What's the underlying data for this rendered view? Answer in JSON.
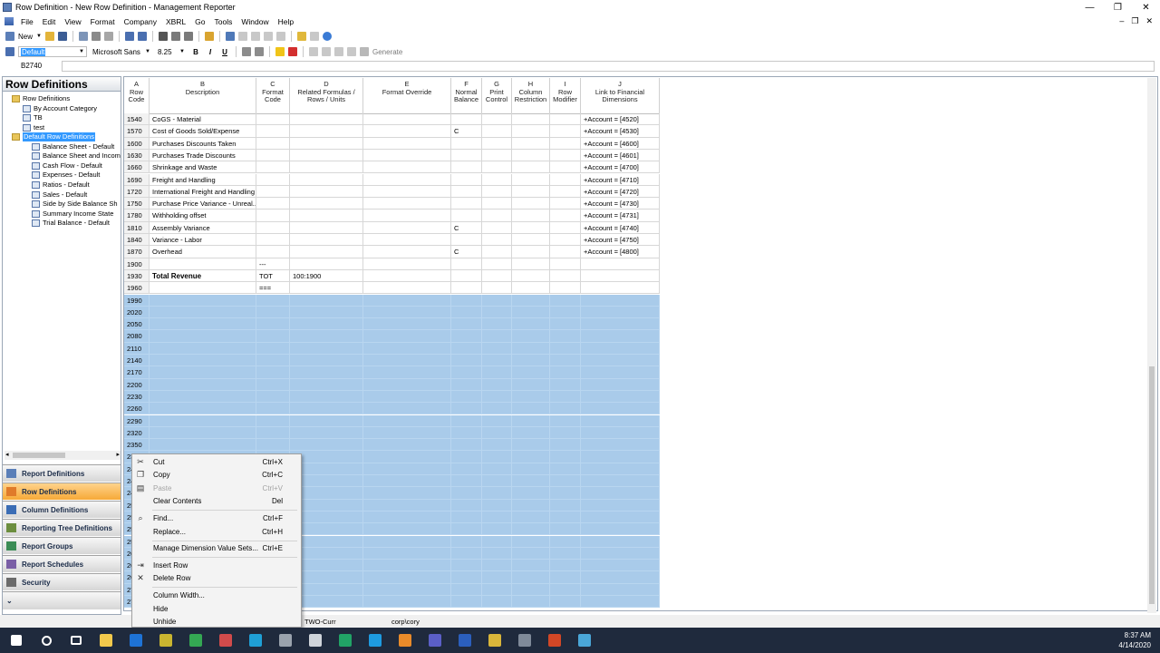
{
  "window": {
    "title": "Row Definition - New Row Definition - Management Reporter"
  },
  "menu": [
    "File",
    "Edit",
    "View",
    "Format",
    "Company",
    "XBRL",
    "Go",
    "Tools",
    "Window",
    "Help"
  ],
  "toolbar1": {
    "new_label": "New"
  },
  "toolbar2": {
    "style": "Default",
    "font": "Microsoft Sans",
    "size": "8.25",
    "bold": "B",
    "italic": "I",
    "underline": "U",
    "generate": "Generate"
  },
  "formula": {
    "cell_ref": "B2740",
    "value": ""
  },
  "left": {
    "header": "Row Definitions",
    "tree": [
      {
        "label": "Row Definitions",
        "level": 0,
        "type": "folder"
      },
      {
        "label": "By Account Category",
        "level": 1,
        "type": "sheet"
      },
      {
        "label": "TB",
        "level": 1,
        "type": "sheet"
      },
      {
        "label": "test",
        "level": 1,
        "type": "sheet"
      },
      {
        "label": "Default Row Definitions",
        "level": 0,
        "type": "folder",
        "selected": true
      },
      {
        "label": "Balance Sheet - Default",
        "level": 2,
        "type": "sheet"
      },
      {
        "label": "Balance Sheet and Income",
        "level": 2,
        "type": "sheet"
      },
      {
        "label": "Cash Flow - Default",
        "level": 2,
        "type": "sheet"
      },
      {
        "label": "Expenses - Default",
        "level": 2,
        "type": "sheet"
      },
      {
        "label": "Ratios - Default",
        "level": 2,
        "type": "sheet"
      },
      {
        "label": "Sales - Default",
        "level": 2,
        "type": "sheet"
      },
      {
        "label": "Side by Side Balance Sh",
        "level": 2,
        "type": "sheet"
      },
      {
        "label": "Summary Income State",
        "level": 2,
        "type": "sheet"
      },
      {
        "label": "Trial Balance - Default",
        "level": 2,
        "type": "sheet"
      }
    ],
    "nav": [
      {
        "label": "Report Definitions",
        "active": false
      },
      {
        "label": "Row Definitions",
        "active": true
      },
      {
        "label": "Column Definitions",
        "active": false
      },
      {
        "label": "Reporting Tree Definitions",
        "active": false
      },
      {
        "label": "Report Groups",
        "active": false
      },
      {
        "label": "Report Schedules",
        "active": false
      },
      {
        "label": "Security",
        "active": false
      }
    ]
  },
  "grid": {
    "headers": [
      {
        "letter": "A",
        "name": "Row\nCode"
      },
      {
        "letter": "B",
        "name": "Description"
      },
      {
        "letter": "C",
        "name": "Format\nCode"
      },
      {
        "letter": "D",
        "name": "Related Formulas /\nRows / Units"
      },
      {
        "letter": "E",
        "name": "Format Override"
      },
      {
        "letter": "F",
        "name": "Normal\nBalance"
      },
      {
        "letter": "G",
        "name": "Print\nControl"
      },
      {
        "letter": "H",
        "name": "Column\nRestriction"
      },
      {
        "letter": "I",
        "name": "Row\nModifier"
      },
      {
        "letter": "J",
        "name": "Link to Financial\nDimensions"
      }
    ],
    "rows": [
      {
        "code": "1540",
        "desc": "CoGS - Material",
        "fmt": "",
        "rel": "",
        "bal": "",
        "link": "+Account = [4520]"
      },
      {
        "code": "1570",
        "desc": "Cost of Goods Sold/Expense",
        "fmt": "",
        "rel": "",
        "bal": "C",
        "link": "+Account = [4530]"
      },
      {
        "code": "1600",
        "desc": "Purchases Discounts Taken",
        "fmt": "",
        "rel": "",
        "bal": "",
        "link": "+Account = [4600]"
      },
      {
        "code": "1630",
        "desc": "Purchases Trade Discounts",
        "fmt": "",
        "rel": "",
        "bal": "",
        "link": "+Account = [4601]"
      },
      {
        "code": "1660",
        "desc": "Shrinkage and Waste",
        "fmt": "",
        "rel": "",
        "bal": "",
        "link": "+Account = [4700]"
      },
      {
        "code": "1690",
        "desc": "Freight and Handling",
        "fmt": "",
        "rel": "",
        "bal": "",
        "link": "+Account = [4710]"
      },
      {
        "code": "1720",
        "desc": "International Freight and Handling",
        "fmt": "",
        "rel": "",
        "bal": "",
        "link": "+Account = [4720]"
      },
      {
        "code": "1750",
        "desc": "Purchase Price Variance - Unreal...",
        "fmt": "",
        "rel": "",
        "bal": "",
        "link": "+Account = [4730]"
      },
      {
        "code": "1780",
        "desc": "Withholding offset",
        "fmt": "",
        "rel": "",
        "bal": "",
        "link": "+Account = [4731]"
      },
      {
        "code": "1810",
        "desc": "Assembly Variance",
        "fmt": "",
        "rel": "",
        "bal": "C",
        "link": "+Account = [4740]"
      },
      {
        "code": "1840",
        "desc": "Variance - Labor",
        "fmt": "",
        "rel": "",
        "bal": "",
        "link": "+Account = [4750]"
      },
      {
        "code": "1870",
        "desc": "Overhead",
        "fmt": "",
        "rel": "",
        "bal": "C",
        "link": "+Account = [4800]"
      },
      {
        "code": "1900",
        "desc": "",
        "fmt": "---",
        "rel": "",
        "bal": "",
        "link": ""
      },
      {
        "code": "1930",
        "desc": "Total Revenue",
        "fmt": "TOT",
        "rel": "100:1900",
        "bal": "",
        "link": "",
        "bold": true
      },
      {
        "code": "1960",
        "desc": "",
        "fmt": "===",
        "rel": "",
        "bal": "",
        "link": ""
      }
    ],
    "selected_rows": [
      "1990",
      "2020",
      "2050",
      "2080",
      "2110",
      "2140",
      "2170",
      "2200",
      "2230",
      "2260",
      "2290",
      "2320",
      "2350",
      "2380",
      "2410",
      "2440",
      "2470",
      "2500",
      "2530",
      "2560",
      "2590",
      "2620",
      "2650",
      "2680",
      "2710",
      "2740"
    ]
  },
  "context_menu": [
    {
      "label": "Cut",
      "shortcut": "Ctrl+X",
      "icon": "cut-icon",
      "glyph": "✂",
      "disabled": false
    },
    {
      "label": "Copy",
      "shortcut": "Ctrl+C",
      "icon": "copy-icon",
      "glyph": "❐",
      "disabled": false
    },
    {
      "label": "Paste",
      "shortcut": "Ctrl+V",
      "icon": "paste-icon",
      "glyph": "▤",
      "disabled": true
    },
    {
      "label": "Clear Contents",
      "shortcut": "Del",
      "icon": "",
      "glyph": "",
      "disabled": false
    },
    {
      "sep": true
    },
    {
      "label": "Find...",
      "shortcut": "Ctrl+F",
      "icon": "binoculars-icon",
      "glyph": "⌕",
      "disabled": false
    },
    {
      "label": "Replace...",
      "shortcut": "Ctrl+H",
      "icon": "",
      "glyph": "",
      "disabled": false
    },
    {
      "sep": true
    },
    {
      "label": "Manage Dimension Value Sets...",
      "shortcut": "Ctrl+E",
      "icon": "",
      "glyph": "",
      "disabled": false
    },
    {
      "sep": true
    },
    {
      "label": "Insert Row",
      "shortcut": "",
      "icon": "insert-row-icon",
      "glyph": "⇥",
      "disabled": false
    },
    {
      "label": "Delete Row",
      "shortcut": "",
      "icon": "delete-icon",
      "glyph": "✕",
      "disabled": false
    },
    {
      "sep": true
    },
    {
      "label": "Column Width...",
      "shortcut": "",
      "icon": "",
      "glyph": "",
      "disabled": false
    },
    {
      "label": "Hide",
      "shortcut": "",
      "icon": "",
      "glyph": "",
      "disabled": false
    },
    {
      "label": "Unhide",
      "shortcut": "",
      "icon": "",
      "glyph": "",
      "disabled": false
    }
  ],
  "status": {
    "company": "TWO-Curr",
    "user": "corp\\cory"
  },
  "taskbar": {
    "time": "8:37 AM",
    "date": "4/14/2020",
    "apps": [
      {
        "name": "file-explorer-icon",
        "color": "#f2c94c"
      },
      {
        "name": "outlook-icon",
        "color": "#1e73d6"
      },
      {
        "name": "notepad-icon",
        "color": "#c9b530"
      },
      {
        "name": "chrome-icon",
        "color": "#34a853"
      },
      {
        "name": "tool-icon",
        "color": "#d14b4b"
      },
      {
        "name": "edge-icon",
        "color": "#1fa0d6"
      },
      {
        "name": "cloud-icon",
        "color": "#9aa3ad"
      },
      {
        "name": "calculator-icon",
        "color": "#cfd4da"
      },
      {
        "name": "excel-icon",
        "color": "#21a366"
      },
      {
        "name": "skype-icon",
        "color": "#1e9be0"
      },
      {
        "name": "tool2-icon",
        "color": "#e98b2a"
      },
      {
        "name": "teams-icon",
        "color": "#5b5fc7"
      },
      {
        "name": "app-icon",
        "color": "#2b5fbd"
      },
      {
        "name": "app2-icon",
        "color": "#d9b63a"
      },
      {
        "name": "management-reporter-icon",
        "color": "#7f8a99"
      },
      {
        "name": "powerpoint-icon",
        "color": "#d24726"
      },
      {
        "name": "snowflake-icon",
        "color": "#4aa7d8"
      }
    ]
  }
}
